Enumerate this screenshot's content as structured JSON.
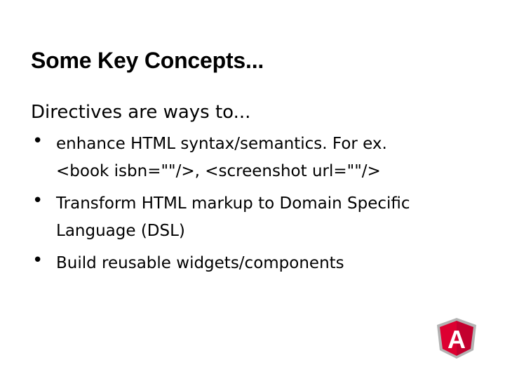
{
  "slide": {
    "title": "Some Key Concepts...",
    "intro": "Directives are ways to...",
    "bullets": [
      {
        "lines": [
          "enhance HTML syntax/semantics. For ex.",
          "<book isbn=\"\"/>, <screenshot url=\"\"/>"
        ]
      },
      {
        "lines": [
          "Transform HTML markup to Domain Specific",
          "Language (DSL)"
        ]
      },
      {
        "lines": [
          "Build reusable widgets/components"
        ]
      }
    ],
    "bullet_symbol": "•",
    "logo": {
      "icon": "angular-logo-icon",
      "letter": "A",
      "colors": {
        "outer": "#b3b3b3",
        "left": "#dd0031",
        "right": "#c3002f",
        "letter": "#ffffff"
      }
    }
  }
}
